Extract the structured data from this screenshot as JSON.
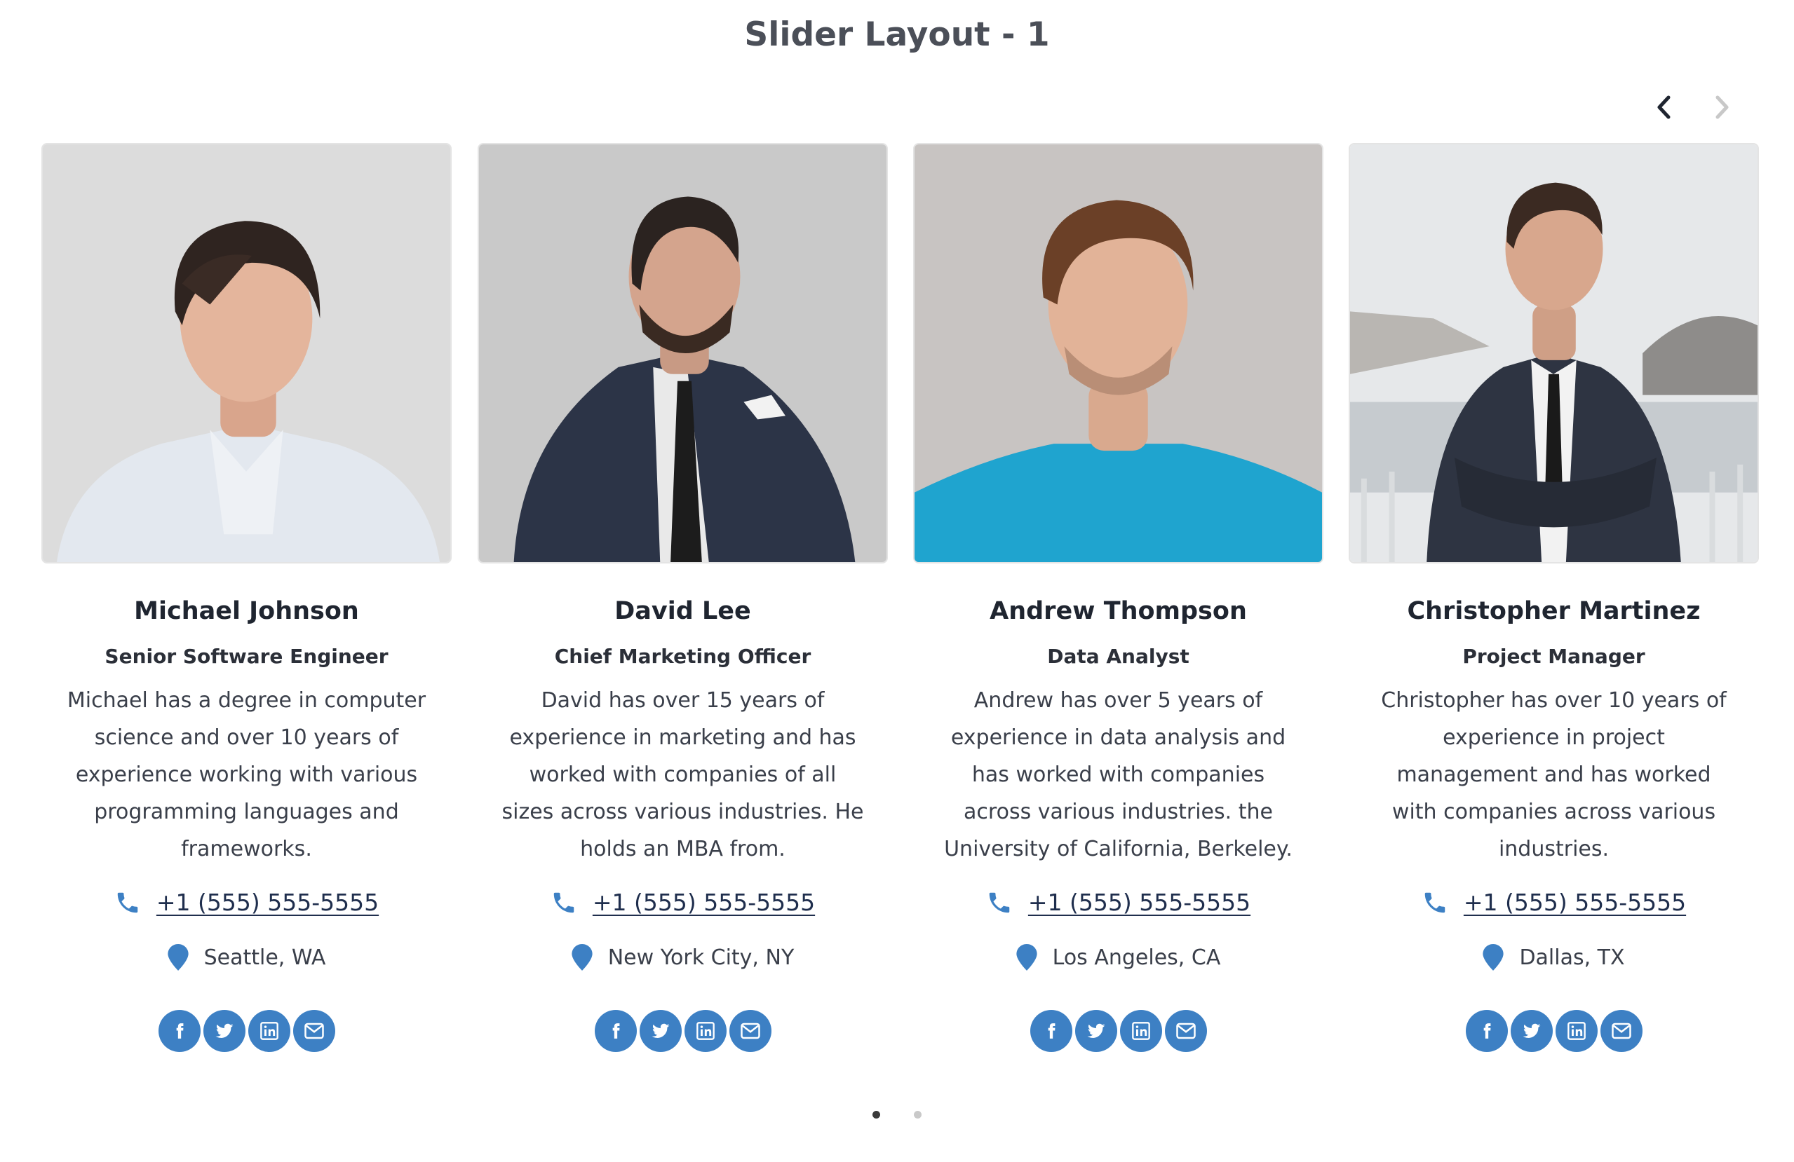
{
  "page": {
    "title": "Slider Layout - 1"
  },
  "colors": {
    "accent": "#3d80c4",
    "heading": "#4b4f58",
    "text": "#3a3f4a"
  },
  "slider": {
    "prev_icon": "chevron-left-icon",
    "next_icon": "chevron-right-icon",
    "active_page": 1,
    "page_count": 2
  },
  "cards": [
    {
      "name": "Michael Johnson",
      "title": "Senior Software Engineer",
      "description": "Michael has a degree in computer science and over 10 years of experience working with various programming languages and frameworks.",
      "phone": "+1 (555) 555-5555",
      "location": "Seattle, WA"
    },
    {
      "name": "David Lee",
      "title": "Chief Marketing Officer",
      "description": "David has over 15 years of experience in marketing and has worked with companies of all sizes across various industries. He holds an MBA from.",
      "phone": "+1 (555) 555-5555",
      "location": "New York City, NY"
    },
    {
      "name": "Andrew Thompson",
      "title": "Data Analyst",
      "description": "Andrew has over 5 years of experience in data analysis and has worked with companies across various industries. the University of California, Berkeley.",
      "phone": "+1 (555) 555-5555",
      "location": "Los Angeles, CA"
    },
    {
      "name": "Christopher Martinez",
      "title": "Project Manager",
      "description": "Christopher has over 10 years of experience in project management and has worked with companies across various industries.",
      "phone": "+1 (555) 555-5555",
      "location": "Dallas, TX"
    }
  ],
  "social_icons": [
    "facebook-icon",
    "twitter-icon",
    "linkedin-icon",
    "email-icon"
  ]
}
